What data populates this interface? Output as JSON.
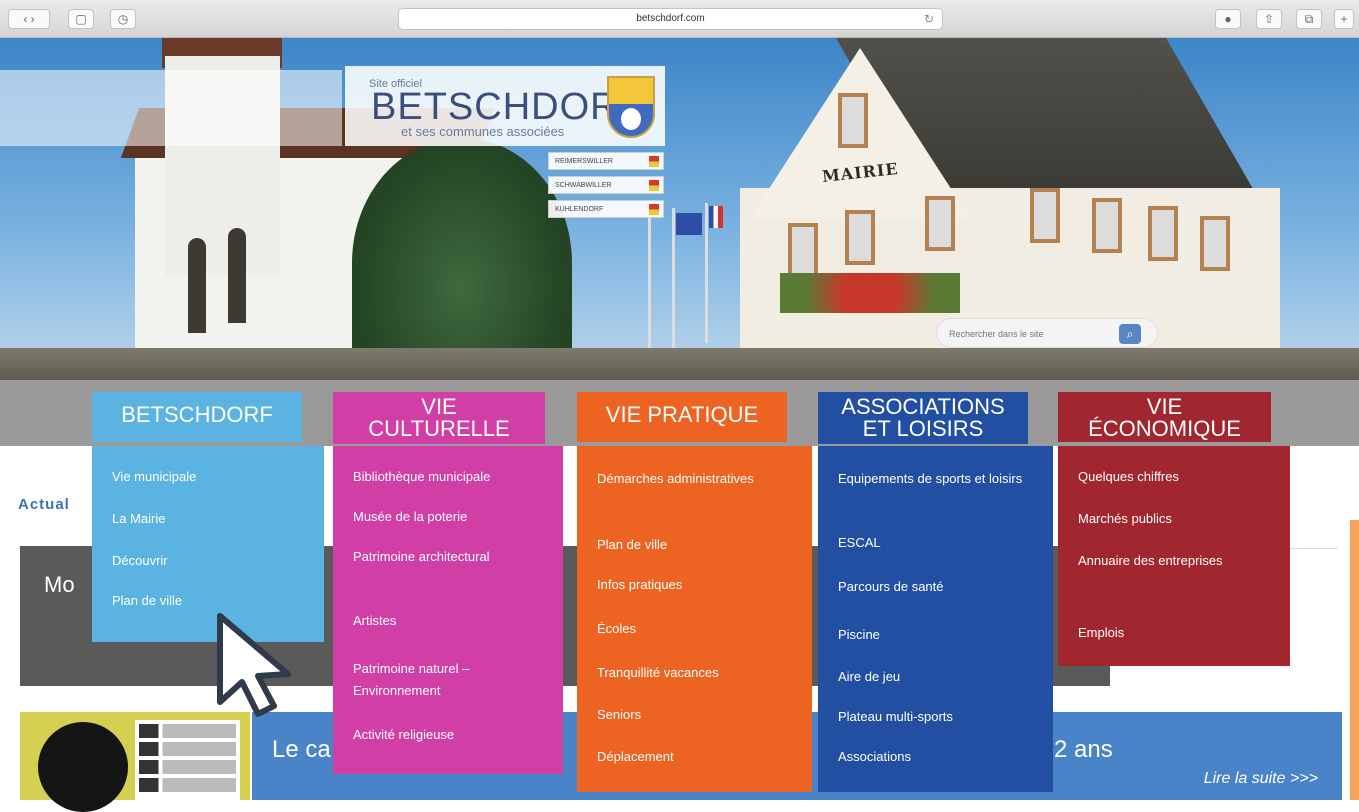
{
  "browser": {
    "url": "betschdorf.com",
    "back_icon": "chevron-left-icon",
    "forward_icon": "chevron-right-icon"
  },
  "site": {
    "logo_small": "Site officiel",
    "logo_main": "BETSCHDORF",
    "logo_sub": "et ses communes associées",
    "communes": [
      "REIMERSWILLER",
      "SCHWABWILLER",
      "KUHLENDORF"
    ],
    "building_label": "MAIRIE",
    "search_placeholder": "Rechercher dans le site"
  },
  "menu": [
    {
      "title_lines": [
        "BETSCHDORF"
      ],
      "color": "#5ab3e1",
      "items": [
        "Vie municipale",
        "La Mairie",
        "Découvrir",
        "Plan de ville"
      ]
    },
    {
      "title_lines": [
        "VIE",
        "CULTURELLE"
      ],
      "color": "#d13fa6",
      "items": [
        "Bibliothèque municipale",
        "Musée de la poterie",
        "Patrimoine architectural",
        "Artistes",
        "Patrimoine naturel – Environnement",
        "Activité religieuse"
      ]
    },
    {
      "title_lines": [
        "VIE PRATIQUE"
      ],
      "color": "#ed6321",
      "items": [
        "Démarches administratives",
        "Plan de ville",
        "Infos pratiques",
        "Écoles",
        "Tranquillité vacances",
        "Seniors",
        "Déplacement"
      ]
    },
    {
      "title_lines": [
        "ASSOCIATIONS",
        "ET LOISIRS"
      ],
      "color": "#234fa3",
      "items": [
        "Equipements de sports et loisirs",
        "ESCAL",
        "Parcours de santé",
        "Piscine",
        "Aire de jeu",
        "Plateau multi-sports",
        "Associations"
      ]
    },
    {
      "title_lines": [
        "VIE",
        "ÉCONOMIQUE"
      ],
      "color": "#a2262f",
      "items": [
        "Quelques chiffres",
        "Marchés publics",
        "Annuaire des entreprises",
        "Emplois"
      ]
    }
  ],
  "content": {
    "actu_label": "Actual",
    "slider_title": "Mo",
    "news_title": "Le ca",
    "news_title_end": "2 ans",
    "read_more": "Lire la suite >>>"
  }
}
